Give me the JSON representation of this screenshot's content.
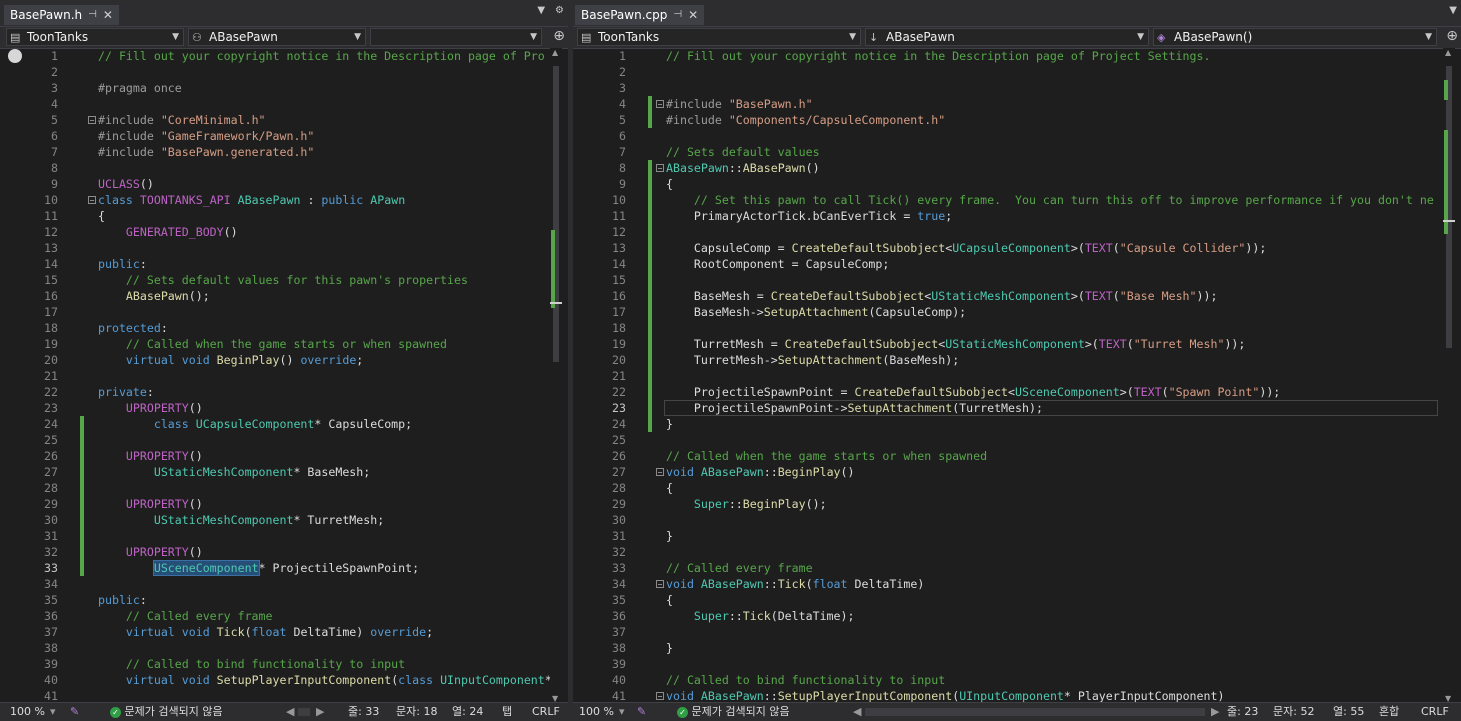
{
  "left": {
    "tab": {
      "title": "BasePawn.h",
      "pin": "⊣",
      "close": "✕"
    },
    "tabbar_icons": [
      "▼",
      "⚙"
    ],
    "nav": {
      "project": "ToonTanks",
      "scope": "ABasePawn",
      "member": ""
    },
    "status": {
      "zoom": "100 %",
      "issues": "문제가 검색되지 않음",
      "line": "줄: 33",
      "char": "문자: 18",
      "col": "열: 24",
      "indent": "탭",
      "eol": "CRLF"
    },
    "lines": [
      [
        [
          "c-com",
          "// Fill out your copyright notice in the Description page of Pro"
        ]
      ],
      [],
      [
        [
          "c-pp",
          "#pragma once"
        ]
      ],
      [],
      [
        [
          "c-pp",
          "#include "
        ],
        [
          "c-str",
          "\"CoreMinimal.h\""
        ]
      ],
      [
        [
          "c-pp",
          "#include "
        ],
        [
          "c-str",
          "\"GameFramework/Pawn.h\""
        ]
      ],
      [
        [
          "c-pp",
          "#include "
        ],
        [
          "c-str",
          "\"BasePawn.generated.h\""
        ]
      ],
      [],
      [
        [
          "c-mac",
          "UCLASS"
        ],
        [
          "c-plain",
          "()"
        ]
      ],
      [
        [
          "c-kw",
          "class "
        ],
        [
          "c-mac",
          "TOONTANKS_API "
        ],
        [
          "c-type",
          "ABasePawn "
        ],
        [
          "c-plain",
          ": "
        ],
        [
          "c-kw",
          "public "
        ],
        [
          "c-type",
          "APawn"
        ]
      ],
      [
        [
          "c-plain",
          "{"
        ]
      ],
      [
        [
          "c-plain",
          "    "
        ],
        [
          "c-mac",
          "GENERATED_BODY"
        ],
        [
          "c-plain",
          "()"
        ]
      ],
      [],
      [
        [
          "c-kw",
          "public"
        ],
        [
          "c-plain",
          ":"
        ]
      ],
      [
        [
          "c-plain",
          "    "
        ],
        [
          "c-com",
          "// Sets default values for this pawn's properties"
        ]
      ],
      [
        [
          "c-plain",
          "    "
        ],
        [
          "c-fn",
          "ABasePawn"
        ],
        [
          "c-plain",
          "();"
        ]
      ],
      [],
      [
        [
          "c-kw",
          "protected"
        ],
        [
          "c-plain",
          ":"
        ]
      ],
      [
        [
          "c-plain",
          "    "
        ],
        [
          "c-com",
          "// Called when the game starts or when spawned"
        ]
      ],
      [
        [
          "c-plain",
          "    "
        ],
        [
          "c-kw",
          "virtual void "
        ],
        [
          "c-fn",
          "BeginPlay"
        ],
        [
          "c-plain",
          "() "
        ],
        [
          "c-kw",
          "override"
        ],
        [
          "c-plain",
          ";"
        ]
      ],
      [],
      [
        [
          "c-kw",
          "private"
        ],
        [
          "c-plain",
          ":"
        ]
      ],
      [
        [
          "c-plain",
          "    "
        ],
        [
          "c-mac",
          "UPROPERTY"
        ],
        [
          "c-plain",
          "()"
        ]
      ],
      [
        [
          "c-plain",
          "        "
        ],
        [
          "c-kw",
          "class "
        ],
        [
          "c-type",
          "UCapsuleComponent"
        ],
        [
          "c-plain",
          "* CapsuleComp;"
        ]
      ],
      [],
      [
        [
          "c-plain",
          "    "
        ],
        [
          "c-mac",
          "UPROPERTY"
        ],
        [
          "c-plain",
          "()"
        ]
      ],
      [
        [
          "c-plain",
          "        "
        ],
        [
          "c-type",
          "UStaticMeshComponent"
        ],
        [
          "c-plain",
          "* BaseMesh;"
        ]
      ],
      [],
      [
        [
          "c-plain",
          "    "
        ],
        [
          "c-mac",
          "UPROPERTY"
        ],
        [
          "c-plain",
          "()"
        ]
      ],
      [
        [
          "c-plain",
          "        "
        ],
        [
          "c-type",
          "UStaticMeshComponent"
        ],
        [
          "c-plain",
          "* TurretMesh;"
        ]
      ],
      [],
      [
        [
          "c-plain",
          "    "
        ],
        [
          "c-mac",
          "UPROPERTY"
        ],
        [
          "c-plain",
          "()"
        ]
      ],
      [
        [
          "c-plain",
          "        "
        ],
        [
          "c-type hl",
          "USceneComponent"
        ],
        [
          "c-plain",
          "* ProjectileSpawnPoint;"
        ]
      ],
      [],
      [
        [
          "c-kw",
          "public"
        ],
        [
          "c-plain",
          ":"
        ]
      ],
      [
        [
          "c-plain",
          "    "
        ],
        [
          "c-com",
          "// Called every frame"
        ]
      ],
      [
        [
          "c-plain",
          "    "
        ],
        [
          "c-kw",
          "virtual void "
        ],
        [
          "c-fn",
          "Tick"
        ],
        [
          "c-plain",
          "("
        ],
        [
          "c-kw",
          "float "
        ],
        [
          "c-plain",
          "DeltaTime) "
        ],
        [
          "c-kw",
          "override"
        ],
        [
          "c-plain",
          ";"
        ]
      ],
      [],
      [
        [
          "c-plain",
          "    "
        ],
        [
          "c-com",
          "// Called to bind functionality to input"
        ]
      ],
      [
        [
          "c-plain",
          "    "
        ],
        [
          "c-kw",
          "virtual void "
        ],
        [
          "c-fn",
          "SetupPlayerInputComponent"
        ],
        [
          "c-plain",
          "("
        ],
        [
          "c-kw",
          "class "
        ],
        [
          "c-type",
          "UInputComponent"
        ],
        [
          "c-plain",
          "*"
        ]
      ],
      [
        [
          "c-plain",
          ""
        ]
      ]
    ]
  },
  "right": {
    "tab": {
      "title": "BasePawn.cpp",
      "pin": "⊣",
      "close": "✕"
    },
    "tabbar_icons": [
      "▼"
    ],
    "nav": {
      "project": "ToonTanks",
      "scope": "ABasePawn",
      "member": "ABasePawn()"
    },
    "status": {
      "zoom": "100 %",
      "issues": "문제가 검색되지 않음",
      "line": "줄: 23",
      "char": "문자: 52",
      "col": "열: 55",
      "indent": "혼합",
      "eol": "CRLF"
    },
    "lines": [
      [
        [
          "c-com",
          "// Fill out your copyright notice in the Description page of Project Settings."
        ]
      ],
      [],
      [],
      [
        [
          "c-pp",
          "#include "
        ],
        [
          "c-str",
          "\"BasePawn.h\""
        ]
      ],
      [
        [
          "c-pp",
          "#include "
        ],
        [
          "c-str",
          "\"Components/CapsuleComponent.h\""
        ]
      ],
      [],
      [
        [
          "c-com",
          "// Sets default values"
        ]
      ],
      [
        [
          "c-type",
          "ABasePawn"
        ],
        [
          "c-plain",
          "::"
        ],
        [
          "c-fn",
          "ABasePawn"
        ],
        [
          "c-plain",
          "()"
        ]
      ],
      [
        [
          "c-plain",
          "{"
        ]
      ],
      [
        [
          "c-plain",
          "    "
        ],
        [
          "c-com",
          "// Set this pawn to call Tick() every frame.  You can turn this off to improve performance if you don't ne"
        ]
      ],
      [
        [
          "c-plain",
          "    PrimaryActorTick.bCanEverTick = "
        ],
        [
          "c-kw",
          "true"
        ],
        [
          "c-plain",
          ";"
        ]
      ],
      [],
      [
        [
          "c-plain",
          "    CapsuleComp = "
        ],
        [
          "c-fn",
          "CreateDefaultSubobject"
        ],
        [
          "c-plain",
          "<"
        ],
        [
          "c-type",
          "UCapsuleComponent"
        ],
        [
          "c-plain",
          ">("
        ],
        [
          "c-mac",
          "TEXT"
        ],
        [
          "c-plain",
          "("
        ],
        [
          "c-str",
          "\"Capsule Collider\""
        ],
        [
          "c-plain",
          "));"
        ]
      ],
      [
        [
          "c-plain",
          "    RootComponent = CapsuleComp;"
        ]
      ],
      [],
      [
        [
          "c-plain",
          "    BaseMesh = "
        ],
        [
          "c-fn",
          "CreateDefaultSubobject"
        ],
        [
          "c-plain",
          "<"
        ],
        [
          "c-type",
          "UStaticMeshComponent"
        ],
        [
          "c-plain",
          ">("
        ],
        [
          "c-mac",
          "TEXT"
        ],
        [
          "c-plain",
          "("
        ],
        [
          "c-str",
          "\"Base Mesh\""
        ],
        [
          "c-plain",
          "));"
        ]
      ],
      [
        [
          "c-plain",
          "    BaseMesh->"
        ],
        [
          "c-fn",
          "SetupAttachment"
        ],
        [
          "c-plain",
          "(CapsuleComp);"
        ]
      ],
      [],
      [
        [
          "c-plain",
          "    TurretMesh = "
        ],
        [
          "c-fn",
          "CreateDefaultSubobject"
        ],
        [
          "c-plain",
          "<"
        ],
        [
          "c-type",
          "UStaticMeshComponent"
        ],
        [
          "c-plain",
          ">("
        ],
        [
          "c-mac",
          "TEXT"
        ],
        [
          "c-plain",
          "("
        ],
        [
          "c-str",
          "\"Turret Mesh\""
        ],
        [
          "c-plain",
          "));"
        ]
      ],
      [
        [
          "c-plain",
          "    TurretMesh->"
        ],
        [
          "c-fn",
          "SetupAttachment"
        ],
        [
          "c-plain",
          "(BaseMesh);"
        ]
      ],
      [],
      [
        [
          "c-plain",
          "    ProjectileSpawnPoint = "
        ],
        [
          "c-fn",
          "CreateDefaultSubobject"
        ],
        [
          "c-plain",
          "<"
        ],
        [
          "c-type",
          "USceneComponent"
        ],
        [
          "c-plain",
          ">("
        ],
        [
          "c-mac",
          "TEXT"
        ],
        [
          "c-plain",
          "("
        ],
        [
          "c-str",
          "\"Spawn Point\""
        ],
        [
          "c-plain",
          "));"
        ]
      ],
      [
        [
          "c-plain",
          "    ProjectileSpawnPoint->"
        ],
        [
          "c-fn",
          "SetupAttachment"
        ],
        [
          "c-plain",
          "(TurretMesh);"
        ]
      ],
      [
        [
          "c-plain",
          "}"
        ]
      ],
      [],
      [
        [
          "c-com",
          "// Called when the game starts or when spawned"
        ]
      ],
      [
        [
          "c-kw",
          "void "
        ],
        [
          "c-type",
          "ABasePawn"
        ],
        [
          "c-plain",
          "::"
        ],
        [
          "c-fn",
          "BeginPlay"
        ],
        [
          "c-plain",
          "()"
        ]
      ],
      [
        [
          "c-plain",
          "{"
        ]
      ],
      [
        [
          "c-plain",
          "    "
        ],
        [
          "c-type",
          "Super"
        ],
        [
          "c-plain",
          "::"
        ],
        [
          "c-fn",
          "BeginPlay"
        ],
        [
          "c-plain",
          "();"
        ]
      ],
      [],
      [
        [
          "c-plain",
          "}"
        ]
      ],
      [],
      [
        [
          "c-com",
          "// Called every frame"
        ]
      ],
      [
        [
          "c-kw",
          "void "
        ],
        [
          "c-type",
          "ABasePawn"
        ],
        [
          "c-plain",
          "::"
        ],
        [
          "c-fn",
          "Tick"
        ],
        [
          "c-plain",
          "("
        ],
        [
          "c-kw",
          "float "
        ],
        [
          "c-plain",
          "DeltaTime)"
        ]
      ],
      [
        [
          "c-plain",
          "{"
        ]
      ],
      [
        [
          "c-plain",
          "    "
        ],
        [
          "c-type",
          "Super"
        ],
        [
          "c-plain",
          "::"
        ],
        [
          "c-fn",
          "Tick"
        ],
        [
          "c-plain",
          "(DeltaTime);"
        ]
      ],
      [],
      [
        [
          "c-plain",
          "}"
        ]
      ],
      [],
      [
        [
          "c-com",
          "// Called to bind functionality to input"
        ]
      ],
      [
        [
          "c-kw",
          "void "
        ],
        [
          "c-type",
          "ABasePawn"
        ],
        [
          "c-plain",
          "::"
        ],
        [
          "c-fn",
          "SetupPlayerInputComponent"
        ],
        [
          "c-plain",
          "("
        ],
        [
          "c-type",
          "UInputComponent"
        ],
        [
          "c-plain",
          "* PlayerInputComponent)"
        ]
      ]
    ]
  },
  "colors": {
    "comment": "#57a64a",
    "keyword": "#569cd6",
    "type": "#4ec9b0",
    "string": "#d69d85",
    "function": "#dcdcaa",
    "macro": "#bd63c5",
    "change_bar": "#57a64a"
  },
  "icons": [
    "file-icon",
    "class-icon",
    "method-icon",
    "split-icon",
    "ok-icon",
    "pin-icon",
    "close-icon",
    "gear-icon"
  ]
}
